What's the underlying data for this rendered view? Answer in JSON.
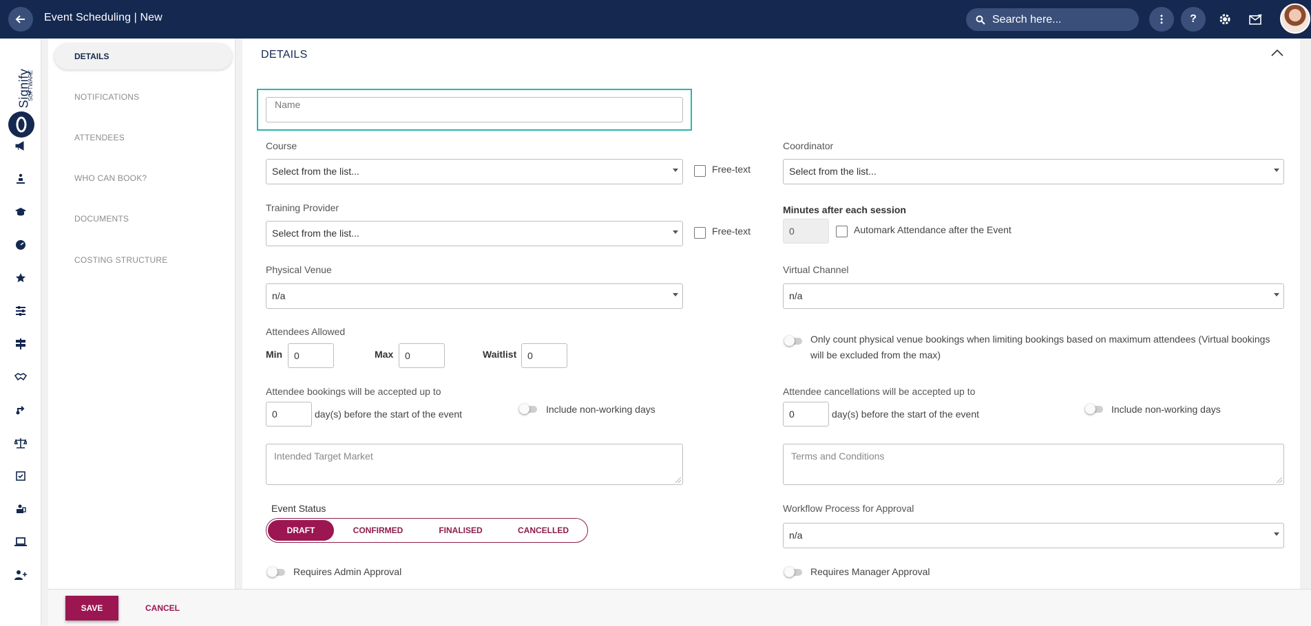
{
  "app": {
    "title": "Event Scheduling | New",
    "search_placeholder": "Search here...",
    "back_icon": "arrow-left-icon",
    "brand_text": "Signify",
    "brand_sub": "SOFTWARE"
  },
  "rail": {
    "icons": [
      "megaphone-icon",
      "user-sitting-icon",
      "graduation-cap-icon",
      "gauge-icon",
      "star-icon",
      "sliders-icon",
      "signpost-icon",
      "handshake-icon",
      "route-icon",
      "scale-icon",
      "checklist-icon",
      "user-desk-icon",
      "laptop-icon",
      "user-plus-icon"
    ]
  },
  "section_nav": {
    "active": "DETAILS",
    "items": [
      "NOTIFICATIONS",
      "ATTENDEES",
      "WHO CAN BOOK?",
      "DOCUMENTS",
      "COSTING STRUCTURE"
    ]
  },
  "details": {
    "title": "DETAILS",
    "name_placeholder": "Name",
    "course_label": "Course",
    "course_value": "Select from the list...",
    "free_text": "Free-text",
    "coordinator_label": "Coordinator",
    "coordinator_value": "Select from the list...",
    "training_provider_label": "Training Provider",
    "training_provider_value": "Select from the list...",
    "minutes_label": "Minutes after each session",
    "minutes_value": "0",
    "automark_label": "Automark Attendance after the Event",
    "physical_venue_label": "Physical Venue",
    "physical_venue_value": "n/a",
    "virtual_channel_label": "Virtual Channel",
    "virtual_channel_value": "n/a",
    "attendees_allowed_label": "Attendees Allowed",
    "min_label": "Min",
    "min_value": "0",
    "max_label": "Max",
    "max_value": "0",
    "waitlist_label": "Waitlist",
    "waitlist_value": "0",
    "count_physical_label_1": "Only count physical venue bookings when limiting bookings based on maximum attendees (Virtual bookings",
    "count_physical_label_2": "will be excluded from the max)",
    "bookings_label": "Attendee bookings will be accepted up to",
    "bookings_value": "0",
    "days_before": "day(s) before the start of the event",
    "include_non_working": "Include non-working days",
    "cancellations_label": "Attendee cancellations will be accepted up to",
    "cancellations_value": "0",
    "target_market_placeholder": "Intended Target Market",
    "terms_placeholder": "Terms and Conditions",
    "event_status_label": "Event Status",
    "statuses": [
      "DRAFT",
      "CONFIRMED",
      "FINALISED",
      "CANCELLED"
    ],
    "active_status": "DRAFT",
    "workflow_label": "Workflow Process for Approval",
    "workflow_value": "n/a",
    "requires_admin": "Requires Admin Approval",
    "requires_manager": "Requires Manager Approval"
  },
  "footer": {
    "save": "SAVE",
    "cancel": "CANCEL"
  },
  "colors": {
    "topbar": "#142850",
    "accent": "#9c1651",
    "highlight": "#2bb3ad"
  }
}
